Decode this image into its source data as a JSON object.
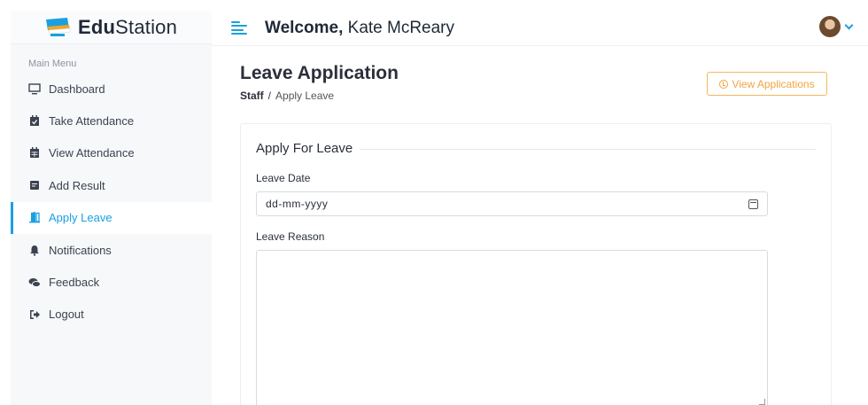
{
  "brand": {
    "name_bold": "Edu",
    "name_rest": "Station"
  },
  "header": {
    "welcome_label": "Welcome,",
    "user_name": "Kate McReary"
  },
  "sidebar": {
    "section_label": "Main Menu",
    "items": [
      {
        "label": "Dashboard",
        "icon": "monitor-icon"
      },
      {
        "label": "Take Attendance",
        "icon": "calendar-check-icon"
      },
      {
        "label": "View Attendance",
        "icon": "calendar-icon"
      },
      {
        "label": "Add Result",
        "icon": "file-icon"
      },
      {
        "label": "Apply Leave",
        "icon": "door-open-icon",
        "active": true
      },
      {
        "label": "Notifications",
        "icon": "bell-icon"
      },
      {
        "label": "Feedback",
        "icon": "comments-icon"
      },
      {
        "label": "Logout",
        "icon": "sign-out-icon"
      }
    ]
  },
  "page": {
    "title": "Leave Application",
    "breadcrumb_root": "Staff",
    "breadcrumb_sep": "/",
    "breadcrumb_current": "Apply Leave",
    "view_button": "View Applications"
  },
  "form": {
    "legend": "Apply For Leave",
    "date_label": "Leave Date",
    "date_placeholder": "dd-mm-yyyy",
    "reason_label": "Leave Reason",
    "reason_value": ""
  },
  "colors": {
    "accent": "#1aa0e0",
    "warning": "#f0a540",
    "brand_orange": "#f5a623"
  }
}
